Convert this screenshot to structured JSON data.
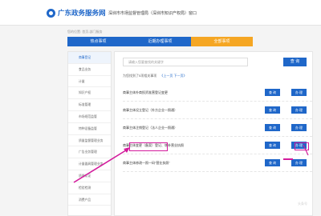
{
  "header": {
    "site_name": "广东政务服务网",
    "department": "深圳市市场监督管理局（深圳市知识产权局）窗口"
  },
  "breadcrumb": "您的位置: 首页-部门服务",
  "tabs": [
    {
      "label": "热点事项"
    },
    {
      "label": "近期办理事项"
    },
    {
      "label": "全部事项"
    }
  ],
  "sidebar": {
    "items": [
      {
        "label": "商事登记"
      },
      {
        "label": "食品业务"
      },
      {
        "label": "计量"
      },
      {
        "label": "知识产权"
      },
      {
        "label": "标准管理"
      },
      {
        "label": "市场规范监管"
      },
      {
        "label": "特种设备监管"
      },
      {
        "label": "质量监督管理业务"
      },
      {
        "label": "广告业务管理"
      },
      {
        "label": "计量器具管理业务"
      },
      {
        "label": "质量认证"
      },
      {
        "label": "检验检测"
      },
      {
        "label": "消费产品"
      }
    ]
  },
  "main": {
    "search_placeholder": "请输入您要查找的关键字",
    "search_button": "查 询",
    "hint": "为您找到了5项相关事项",
    "pager": "《上一页   下一页》",
    "rows": [
      {
        "name": "商事主体外商投资准营登记变更"
      },
      {
        "name": "商事主体设立登记（外方企业一照通）"
      },
      {
        "name": "商事主体注销登记（法人企业一照通）"
      },
      {
        "name": "商事主体变更（备案）登记、增补营业执照"
      },
      {
        "name": "商事主体修改一照一码“营业执照”"
      }
    ],
    "query_label": "查 询",
    "handle_label": "办 理"
  },
  "watermark": "头条号"
}
